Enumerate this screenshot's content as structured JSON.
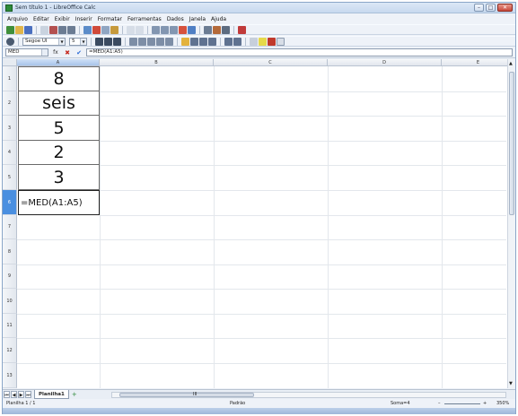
{
  "window": {
    "title": "Sem título 1 - LibreOffice Calc",
    "minimize": "–",
    "maximize": "□",
    "close": "✕"
  },
  "menu": [
    "Arquivo",
    "Editar",
    "Exibir",
    "Inserir",
    "Formatar",
    "Ferramentas",
    "Dados",
    "Janela",
    "Ajuda"
  ],
  "toolbar": {
    "font_name": "Segoe UI",
    "font_size": "5"
  },
  "formula_bar": {
    "name_box": "MED",
    "fx": "fx",
    "cancel": "✖",
    "accept": "✔",
    "content": "=MED(A1:A5)"
  },
  "columns": [
    "A",
    "B",
    "C",
    "D",
    "E"
  ],
  "rows": [
    "1",
    "2",
    "3",
    "4",
    "5",
    "6",
    "7",
    "8",
    "9",
    "10",
    "11",
    "12",
    "13"
  ],
  "active": {
    "column": "A",
    "row": "6"
  },
  "cells": [
    {
      "ref": "A1",
      "value": "8"
    },
    {
      "ref": "A2",
      "value": "seis"
    },
    {
      "ref": "A3",
      "value": "5"
    },
    {
      "ref": "A4",
      "value": "2"
    },
    {
      "ref": "A5",
      "value": "3"
    },
    {
      "ref": "A6",
      "value": "=MED(A1:A5)"
    }
  ],
  "sheet_tabs": {
    "tab_name": "Planilha1",
    "scroll_marker": "III"
  },
  "status": {
    "sheet": "Planilha 1 / 1",
    "style": "Padrão",
    "sum": "Soma=4",
    "zoom": "350%",
    "zoom_minus": "–",
    "zoom_plus": "+"
  },
  "colors": {
    "accent": "#4a8fe0",
    "title_bg": "#c7d9ef"
  }
}
